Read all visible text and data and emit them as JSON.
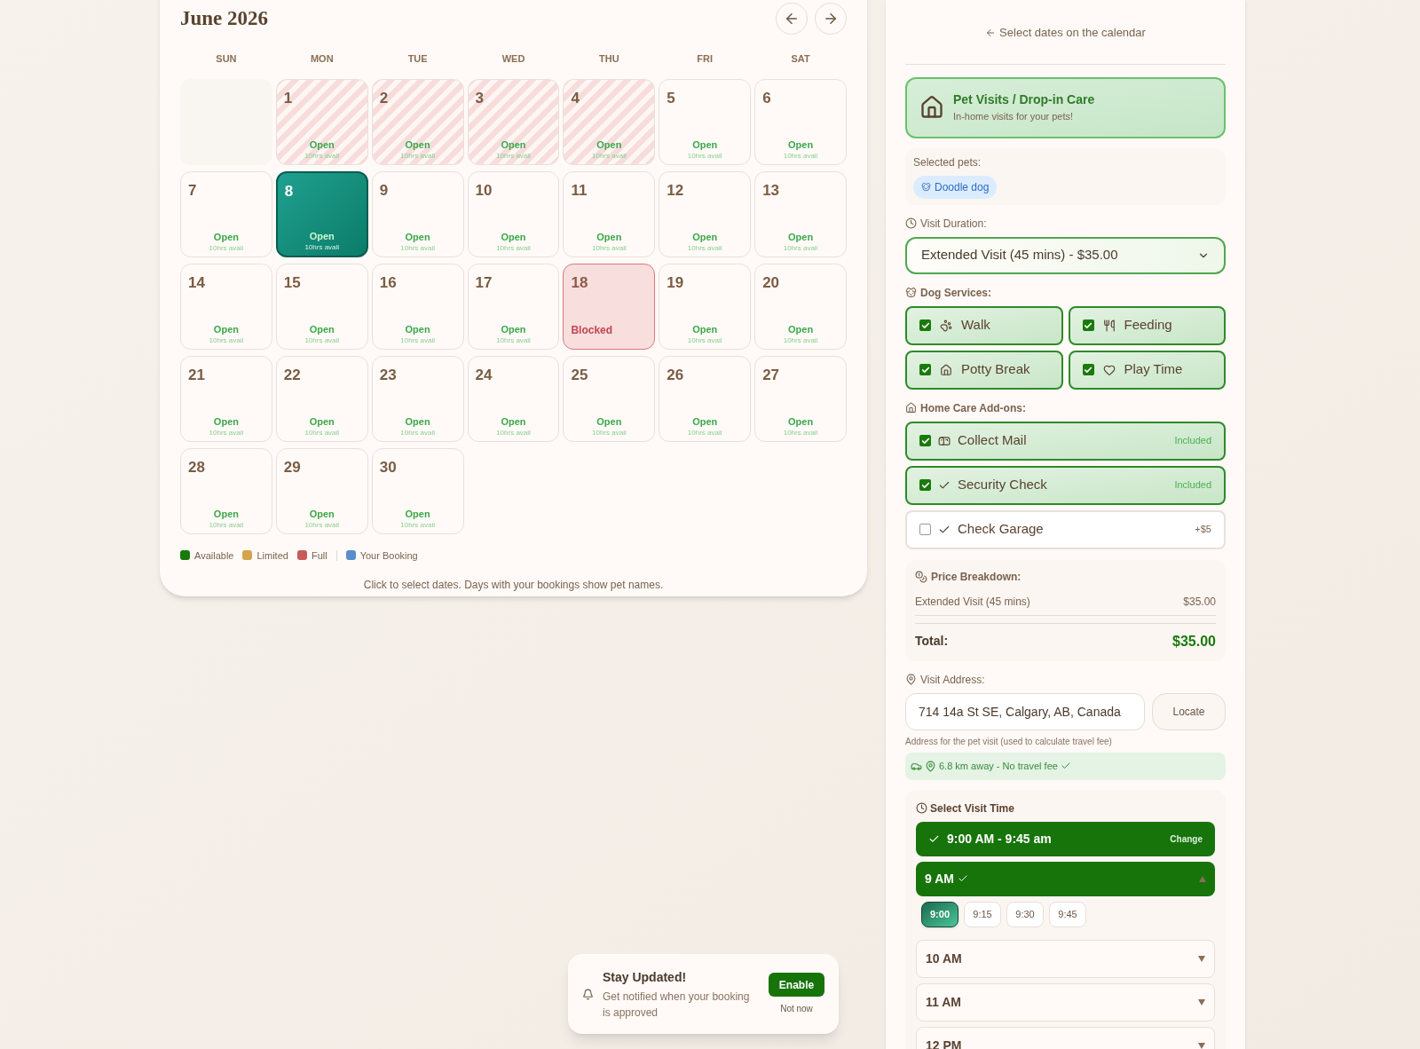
{
  "calendar": {
    "title": "June 2026",
    "weekdays": [
      "SUN",
      "MON",
      "TUE",
      "WED",
      "THU",
      "FRI",
      "SAT"
    ],
    "days": [
      {
        "kind": "empty"
      },
      {
        "kind": "striped",
        "number": "1",
        "status": "Open",
        "avail": "10hrs avail",
        "selected": false
      },
      {
        "kind": "striped",
        "number": "2",
        "status": "Open",
        "avail": "10hrs avail",
        "selected": false
      },
      {
        "kind": "striped",
        "number": "3",
        "status": "Open",
        "avail": "10hrs avail",
        "selected": false
      },
      {
        "kind": "striped",
        "number": "4",
        "status": "Open",
        "avail": "10hrs avail",
        "selected": false
      },
      {
        "kind": "open",
        "number": "5",
        "status": "Open",
        "avail": "10hrs avail",
        "selected": false
      },
      {
        "kind": "open",
        "number": "6",
        "status": "Open",
        "avail": "10hrs avail",
        "selected": false
      },
      {
        "kind": "open",
        "number": "7",
        "status": "Open",
        "avail": "10hrs avail",
        "selected": false
      },
      {
        "kind": "open",
        "number": "8",
        "status": "Open",
        "avail": "10hrs avail",
        "selected": true
      },
      {
        "kind": "open",
        "number": "9",
        "status": "Open",
        "avail": "10hrs avail",
        "selected": false
      },
      {
        "kind": "open",
        "number": "10",
        "status": "Open",
        "avail": "10hrs avail",
        "selected": false
      },
      {
        "kind": "open",
        "number": "11",
        "status": "Open",
        "avail": "10hrs avail",
        "selected": false
      },
      {
        "kind": "open",
        "number": "12",
        "status": "Open",
        "avail": "10hrs avail",
        "selected": false
      },
      {
        "kind": "open",
        "number": "13",
        "status": "Open",
        "avail": "10hrs avail",
        "selected": false
      },
      {
        "kind": "open",
        "number": "14",
        "status": "Open",
        "avail": "10hrs avail",
        "selected": false
      },
      {
        "kind": "open",
        "number": "15",
        "status": "Open",
        "avail": "10hrs avail",
        "selected": false
      },
      {
        "kind": "open",
        "number": "16",
        "status": "Open",
        "avail": "10hrs avail",
        "selected": false
      },
      {
        "kind": "open",
        "number": "17",
        "status": "Open",
        "avail": "10hrs avail",
        "selected": false
      },
      {
        "kind": "blocked",
        "number": "18",
        "status": "Blocked",
        "selected": false
      },
      {
        "kind": "open",
        "number": "19",
        "status": "Open",
        "avail": "10hrs avail",
        "selected": false
      },
      {
        "kind": "open",
        "number": "20",
        "status": "Open",
        "avail": "10hrs avail",
        "selected": false
      },
      {
        "kind": "open",
        "number": "21",
        "status": "Open",
        "avail": "10hrs avail",
        "selected": false
      },
      {
        "kind": "open",
        "number": "22",
        "status": "Open",
        "avail": "10hrs avail",
        "selected": false
      },
      {
        "kind": "open",
        "number": "23",
        "status": "Open",
        "avail": "10hrs avail",
        "selected": false
      },
      {
        "kind": "open",
        "number": "24",
        "status": "Open",
        "avail": "10hrs avail",
        "selected": false
      },
      {
        "kind": "open",
        "number": "25",
        "status": "Open",
        "avail": "10hrs avail",
        "selected": false
      },
      {
        "kind": "open",
        "number": "26",
        "status": "Open",
        "avail": "10hrs avail",
        "selected": false
      },
      {
        "kind": "open",
        "number": "27",
        "status": "Open",
        "avail": "10hrs avail",
        "selected": false
      },
      {
        "kind": "open",
        "number": "28",
        "status": "Open",
        "avail": "10hrs avail",
        "selected": false
      },
      {
        "kind": "open",
        "number": "29",
        "status": "Open",
        "avail": "10hrs avail",
        "selected": false
      },
      {
        "kind": "open",
        "number": "30",
        "status": "Open",
        "avail": "10hrs avail",
        "selected": false
      }
    ],
    "legend": [
      {
        "label": "Available",
        "color": "#1a7a0c"
      },
      {
        "label": "Limited",
        "color": "#d4a54e"
      },
      {
        "label": "Full",
        "color": "#c95a5a"
      },
      {
        "label": "Your Booking",
        "color": "#5b8ccc"
      }
    ],
    "hint": "Click to select dates. Days with your bookings show pet names."
  },
  "panel": {
    "back_link": "Select dates on the calendar",
    "service": {
      "title": "Pet Visits / Drop-in Care",
      "subtitle": "In-home visits for your pets!"
    },
    "pets": {
      "label": "Selected pets:",
      "items": [
        "Doodle dog"
      ]
    },
    "duration": {
      "label": "Visit Duration:",
      "value": "Extended Visit (45 mins) - $35.00"
    },
    "dog_services": {
      "label": "Dog Services:",
      "items": [
        {
          "kind": "walk",
          "label": "Walk",
          "checked": true
        },
        {
          "kind": "feeding",
          "label": "Feeding",
          "checked": true
        },
        {
          "kind": "potty",
          "label": "Potty Break",
          "checked": true
        },
        {
          "kind": "play",
          "label": "Play Time",
          "checked": true
        }
      ]
    },
    "addons": {
      "label": "Home Care Add-ons:",
      "items": [
        {
          "kind": "mail",
          "label": "Collect Mail",
          "price": "Included",
          "checked": true
        },
        {
          "kind": "check",
          "label": "Security Check",
          "price": "Included",
          "checked": true
        },
        {
          "kind": "check",
          "label": "Check Garage",
          "price": "+$5",
          "checked": false
        }
      ]
    },
    "price": {
      "label": "Price Breakdown:",
      "lines": [
        {
          "label": "Extended Visit (45 mins)",
          "amount": "$35.00"
        }
      ],
      "total_label": "Total:",
      "total": "$35.00"
    },
    "address": {
      "label": "Visit Address:",
      "value": "714 14a St SE, Calgary, AB, Canada",
      "button": "Locate",
      "hint": "Address for the pet visit (used to calculate travel fee)",
      "distance": "6.8 km away - No travel fee"
    },
    "time": {
      "label": "Select Visit Time",
      "chosen": "9:00 AM - 9:45 am",
      "change": "Change",
      "hours": [
        {
          "label": "9 AM",
          "selected": true,
          "expanded": true,
          "minutes": [
            {
              "label": "9:00",
              "selected": true
            },
            {
              "label": "9:15",
              "selected": false
            },
            {
              "label": "9:30",
              "selected": false
            },
            {
              "label": "9:45",
              "selected": false
            }
          ]
        },
        {
          "label": "10 AM",
          "selected": false,
          "expanded": false
        },
        {
          "label": "11 AM",
          "selected": false,
          "expanded": false
        },
        {
          "label": "12 PM",
          "selected": false,
          "expanded": false
        }
      ]
    }
  },
  "toast": {
    "title": "Stay Updated!",
    "message": "Get notified when your booking is approved",
    "enable": "Enable",
    "dismiss": "Not now"
  }
}
